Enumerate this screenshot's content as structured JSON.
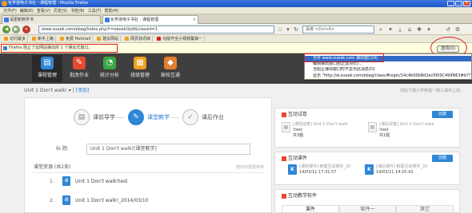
{
  "window": {
    "title": "化学涨电子书社 - 课程管理 - Mozilla Firefox",
    "controls": [
      "_",
      "□",
      "×"
    ]
  },
  "menubar": [
    "文件(F)",
    "编辑(E)",
    "查看(V)",
    "历史(S)",
    "书签(B)",
    "工具(T)",
    "帮助(H)"
  ],
  "tabs": [
    {
      "label": "请更新数学书"
    },
    {
      "label": "化学涨电子书社 - 课程管理"
    }
  ],
  "navbar": {
    "url": "www.xueak.com/ebag/index.php?r=ebook/kjdt&classid=1",
    "search_placeholder": "百度 <Ctrl+K>"
  },
  "bookmarks": [
    "访问最多",
    "新手上路",
    "免费 Hotmail",
    "建议网站",
    "网页快讯库",
    "功能齐全小视频集锦一"
  ],
  "popup": {
    "message": "Firefox 阻止了此网站弹出的 1 个弹出式窗口。",
    "options_button": "选项(O)",
    "menu": [
      "允许 www.xueak.com 弹出窗口(A)",
      "编辑弹出窗口阻止选项(E)...",
      "当阻止弹出窗口时不显示此消息(D)",
      "显示 \"http://w.xueak.com/ebag/class/#login/14c4b00b8d2acf00SC499N63#b??\""
    ]
  },
  "sitenav": [
    {
      "label": "课程管理",
      "color": "#2f86d6",
      "glyph": "▤"
    },
    {
      "label": "批改作业",
      "color": "#e64a2e",
      "glyph": "✎"
    },
    {
      "label": "统计分析",
      "color": "#39a845",
      "glyph": "◔"
    },
    {
      "label": "班级管理",
      "color": "#f0a020",
      "glyph": "▦"
    },
    {
      "label": "家校互通",
      "color": "#e08030",
      "glyph": "◆"
    }
  ],
  "breadcrumb": {
    "current": "Unit 1 Don't walk!",
    "sep": "|",
    "add": "[添加]"
  },
  "top_right_hint": "扫码下载小学英语一期三课件上线",
  "steps": [
    {
      "label": "课前导学",
      "glyph": "▤"
    },
    {
      "label": "课堂教学",
      "glyph": "✎"
    },
    {
      "label": "课后作业",
      "glyph": "✓"
    }
  ],
  "form": {
    "title_label": "标    题:",
    "title_value": "Unit 1 Don't walk![课堂教学]",
    "resources_label": "课堂资源 (共2条)",
    "resources_hint": "拖动可更改排序"
  },
  "resources": [
    {
      "num": "1.",
      "name": "Unit 1 Don't walk!test"
    },
    {
      "num": "2.",
      "name": "Unit 1 Don't walk!_2014/03/10"
    }
  ],
  "sidebar": {
    "quiz": {
      "title": "互动试卷",
      "create": "创建",
      "cards": [
        {
          "line1": "[课前试卷] Unit 1 Don't walk",
          "line2": "!test",
          "line3": "共3题"
        },
        {
          "line1": "[课后试卷] Unit 1 Don't walk",
          "line2": "!test",
          "line3": "共1题"
        }
      ]
    },
    "courseware": {
      "title": "互动课件",
      "create": "创建",
      "cards": [
        {
          "line1": "[课前课件] 新建互动课件_20",
          "line2": "14/03/11 17:31:57"
        },
        {
          "line1": "[课后课件] 新建互动课件_20",
          "line2": "14/03/11 14:25:42"
        }
      ]
    },
    "software": {
      "title": "互动教学软件",
      "tabs": [
        "课件",
        "软件一",
        "其它"
      ]
    }
  }
}
